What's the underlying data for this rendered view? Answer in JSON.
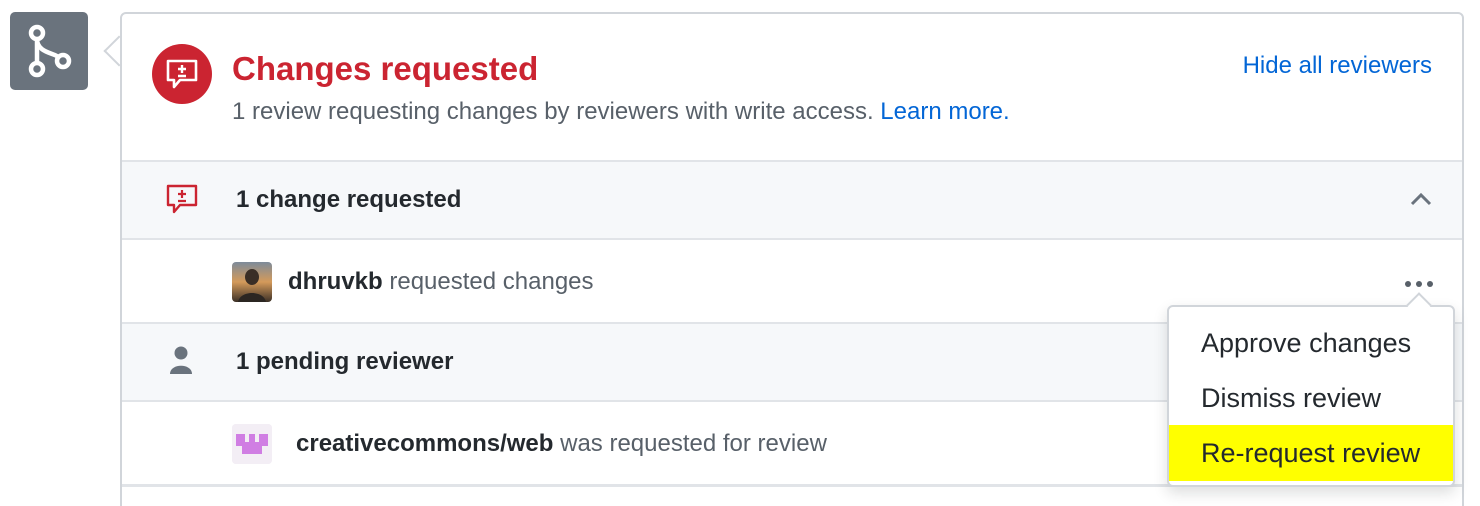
{
  "status": {
    "title": "Changes requested",
    "description": "1 review requesting changes by reviewers with write access.",
    "learn_more": "Learn more.",
    "hide_reviewers": "Hide all reviewers"
  },
  "changes_section": {
    "title": "1 change requested",
    "reviewers": [
      {
        "name": "dhruvkb",
        "action": "requested changes"
      }
    ]
  },
  "pending_section": {
    "title": "1 pending reviewer",
    "reviewers": [
      {
        "name": "creativecommons/web",
        "action": "was requested for review"
      }
    ]
  },
  "menu": {
    "items": [
      "Approve changes",
      "Dismiss review",
      "Re-request review"
    ],
    "highlighted": "Re-request review",
    "highlight_color": "#ffff00"
  },
  "colors": {
    "danger": "#cb2431",
    "link": "#0366d6",
    "muted": "#586069",
    "team_avatar": "#d07ee3"
  },
  "icons": {
    "merge": "git-merge-icon",
    "status": "request-changes-icon",
    "section_changes": "request-changes-icon",
    "section_pending": "person-icon",
    "collapse": "chevron-up-icon",
    "more": "kebab-horizontal-icon"
  }
}
